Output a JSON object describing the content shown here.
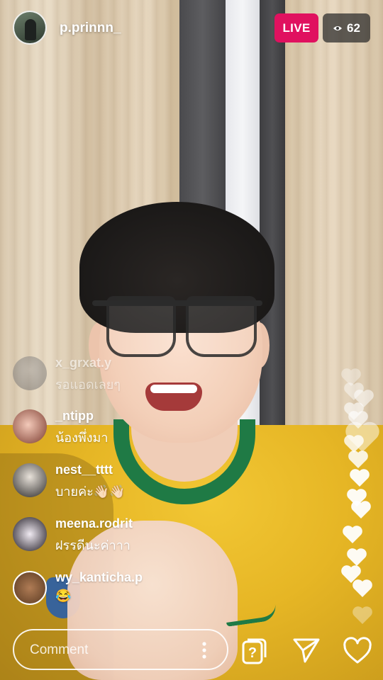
{
  "header": {
    "username": "p.prinnn_",
    "live_label": "LIVE",
    "viewer_count": "62"
  },
  "comments": [
    {
      "username": "x_grxat.y",
      "text": "รอแอดเลยๆ"
    },
    {
      "username": "_ntipp",
      "text": "น้องพึ่งมา"
    },
    {
      "username": "nest__tttt",
      "text": "บายค่ะ👋🏻👋🏻"
    },
    {
      "username": "meena.rodrit",
      "text": "ฝรรดีนะค่าาา"
    },
    {
      "username": "wy_kanticha.p",
      "text": "😂"
    }
  ],
  "footer": {
    "comment_placeholder": "Comment"
  },
  "colors": {
    "live_badge": "#e0115f",
    "viewer_badge": "rgba(40,40,40,0.72)"
  }
}
